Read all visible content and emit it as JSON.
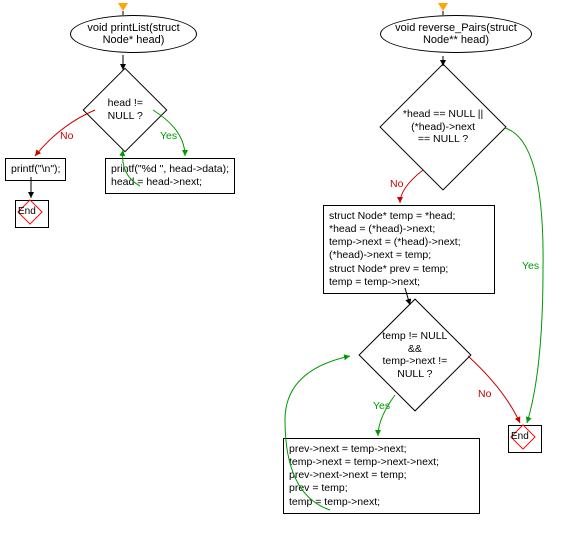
{
  "left": {
    "func_sig": "void printList(struct\nNode* head)",
    "decision1": "head != NULL ?",
    "proc_no": "printf(\"\\n\");",
    "proc_yes": "printf(\"%d \", head->data);\nhead = head->next;",
    "end": "End",
    "labels": {
      "no": "No",
      "yes": "Yes"
    }
  },
  "right": {
    "func_sig": "void reverse_Pairs(struct\nNode** head)",
    "decision1": "*head == NULL || (*head)->next\n== NULL ?",
    "proc1": "struct Node* temp = *head;\n*head = (*head)->next;\ntemp->next = (*head)->next;\n(*head)->next = temp;\nstruct Node* prev = temp;\ntemp = temp->next;",
    "decision2": "temp != NULL &&\ntemp->next != NULL ?",
    "proc2": "prev->next = temp->next;\ntemp->next = temp->next->next;\nprev->next->next = temp;\nprev = temp;\ntemp = temp->next;",
    "end": "End",
    "labels": {
      "no": "No",
      "yes": "Yes"
    }
  },
  "chart_data": {
    "type": "flowchart",
    "flows": [
      {
        "name": "printList",
        "signature": "void printList(struct Node* head)",
        "nodes": [
          {
            "id": "L_start",
            "kind": "start"
          },
          {
            "id": "L_func",
            "kind": "terminal",
            "text": "void printList(struct Node* head)"
          },
          {
            "id": "L_dec",
            "kind": "decision",
            "text": "head != NULL ?"
          },
          {
            "id": "L_no",
            "kind": "process",
            "text": "printf(\"\\n\");"
          },
          {
            "id": "L_yes",
            "kind": "process",
            "text": "printf(\"%d \", head->data);\nhead = head->next;"
          },
          {
            "id": "L_end",
            "kind": "end",
            "text": "End"
          }
        ],
        "edges": [
          {
            "from": "L_start",
            "to": "L_func"
          },
          {
            "from": "L_func",
            "to": "L_dec"
          },
          {
            "from": "L_dec",
            "to": "L_no",
            "label": "No",
            "color": "red"
          },
          {
            "from": "L_dec",
            "to": "L_yes",
            "label": "Yes",
            "color": "green"
          },
          {
            "from": "L_yes",
            "to": "L_dec",
            "label": "",
            "color": "green",
            "loop": true
          },
          {
            "from": "L_no",
            "to": "L_end"
          }
        ]
      },
      {
        "name": "reverse_Pairs",
        "signature": "void reverse_Pairs(struct Node** head)",
        "nodes": [
          {
            "id": "R_start",
            "kind": "start"
          },
          {
            "id": "R_func",
            "kind": "terminal",
            "text": "void reverse_Pairs(struct Node** head)"
          },
          {
            "id": "R_dec1",
            "kind": "decision",
            "text": "*head == NULL || (*head)->next == NULL ?"
          },
          {
            "id": "R_proc1",
            "kind": "process",
            "text": "struct Node* temp = *head;\n*head = (*head)->next;\ntemp->next = (*head)->next;\n(*head)->next = temp;\nstruct Node* prev = temp;\ntemp = temp->next;"
          },
          {
            "id": "R_dec2",
            "kind": "decision",
            "text": "temp != NULL && temp->next != NULL ?"
          },
          {
            "id": "R_proc2",
            "kind": "process",
            "text": "prev->next = temp->next;\ntemp->next = temp->next->next;\nprev->next->next = temp;\nprev = temp;\ntemp = temp->next;"
          },
          {
            "id": "R_end",
            "kind": "end",
            "text": "End"
          }
        ],
        "edges": [
          {
            "from": "R_start",
            "to": "R_func"
          },
          {
            "from": "R_func",
            "to": "R_dec1"
          },
          {
            "from": "R_dec1",
            "to": "R_end",
            "label": "Yes",
            "color": "green"
          },
          {
            "from": "R_dec1",
            "to": "R_proc1",
            "label": "No",
            "color": "red"
          },
          {
            "from": "R_proc1",
            "to": "R_dec2"
          },
          {
            "from": "R_dec2",
            "to": "R_proc2",
            "label": "Yes",
            "color": "green"
          },
          {
            "from": "R_proc2",
            "to": "R_dec2",
            "label": "",
            "color": "green",
            "loop": true
          },
          {
            "from": "R_dec2",
            "to": "R_end",
            "label": "No",
            "color": "red"
          }
        ]
      }
    ]
  }
}
